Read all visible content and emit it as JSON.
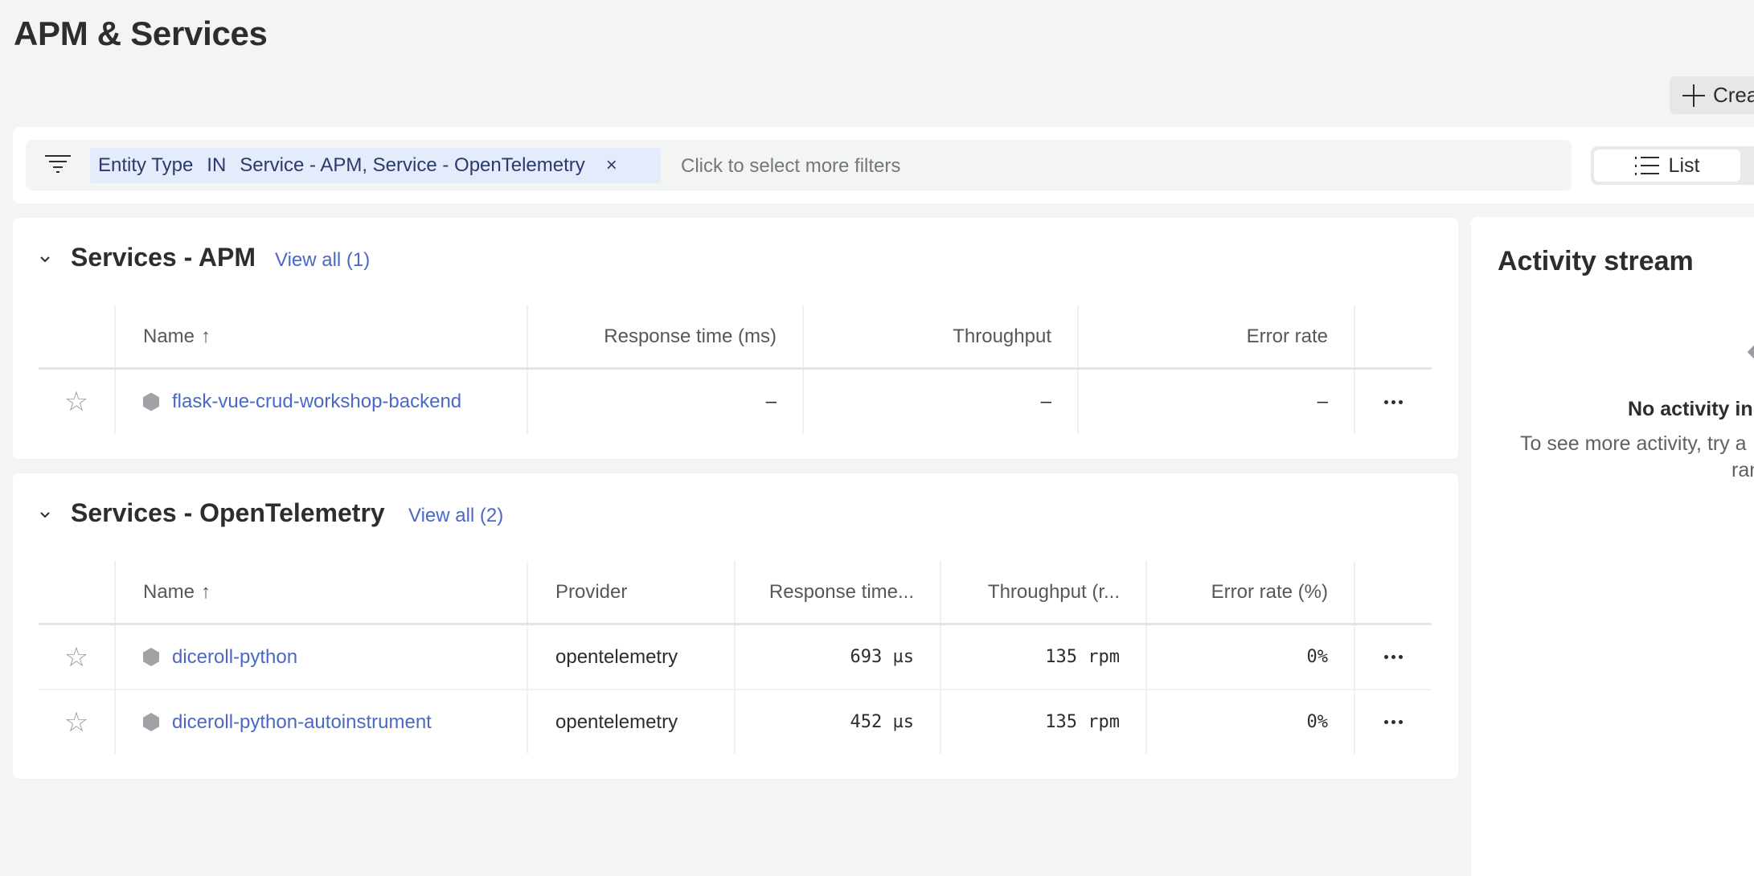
{
  "page": {
    "title": "APM & Services",
    "create_button_label": "Create"
  },
  "filter": {
    "chip": {
      "field": "Entity Type",
      "operator": "IN",
      "values": "Service - APM, Service - OpenTelemetry",
      "close_glyph": "×"
    },
    "placeholder": "Click to select more filters",
    "icon": "filter-icon"
  },
  "view_toggle": {
    "active_label": "List",
    "icon": "list-icon"
  },
  "sections": {
    "apm": {
      "title": "Services - APM",
      "view_all_label": "View all (1)",
      "columns": [
        "Name",
        "Response time (ms)",
        "Throughput",
        "Error rate"
      ],
      "sort_glyph": "↑",
      "rows": [
        {
          "name": "flask-vue-crud-workshop-backend",
          "response_time": "–",
          "throughput": "–",
          "error_rate": "–",
          "starred": false
        }
      ]
    },
    "otel": {
      "title": "Services - OpenTelemetry",
      "view_all_label": "View all (2)",
      "columns": [
        "Name",
        "Provider",
        "Response time...",
        "Throughput (r...",
        "Error rate (%)"
      ],
      "sort_glyph": "↑",
      "rows": [
        {
          "name": "diceroll-python",
          "provider": "opentelemetry",
          "response_time": "693 µs",
          "throughput": "135 rpm",
          "error_rate": "0%",
          "starred": false
        },
        {
          "name": "diceroll-python-autoinstrument",
          "provider": "opentelemetry",
          "response_time": "452 µs",
          "throughput": "135 rpm",
          "error_rate": "0%",
          "starred": false
        }
      ]
    }
  },
  "activity": {
    "title": "Activity stream",
    "empty_title": "No activity in",
    "empty_desc_line1": "To see more activity, try a",
    "empty_desc_line2": "ran"
  },
  "icons": {
    "star": "☆"
  },
  "colors": {
    "background": "#f4f4f4",
    "card": "#ffffff",
    "link": "#4a68c6",
    "chip_bg": "#e4ebfb",
    "chip_text": "#2c3a6b",
    "entity_icon": "#a0a2a5",
    "text_primary": "#2b2d2f",
    "text_secondary": "#55585b"
  }
}
